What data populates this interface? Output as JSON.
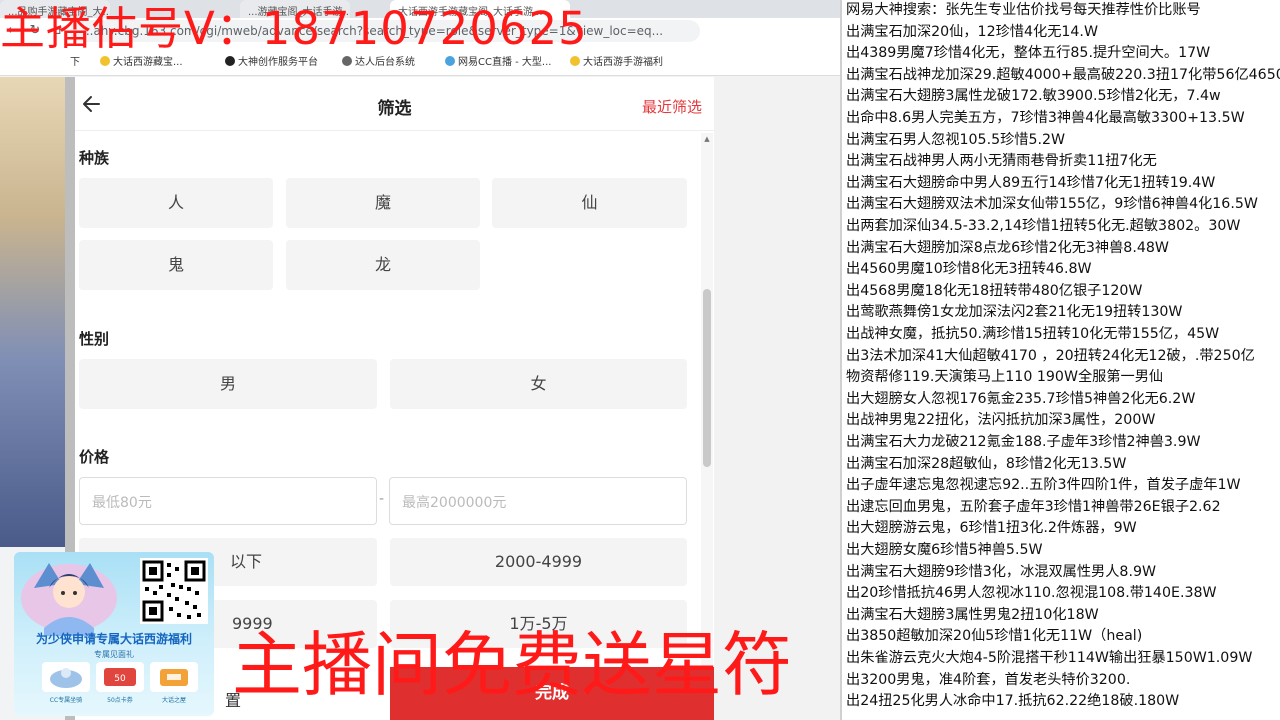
{
  "overlays": {
    "contact_banner": "主播估号V：18710720625",
    "free_banner": "主播间免费送星符"
  },
  "browser": {
    "tabs": [
      "...品购手游藏宝阁_大...",
      "...游藏宝阁_大话手游...",
      "大话西游手游藏宝阁_大话手游..."
    ],
    "url": "...ahy.cbg.163.com/cgi/mweb/advance/search?search_type=role&server_type=1&view_loc=eq...",
    "bookmarks": [
      "下",
      "大话西游藏宝...",
      "大神创作服务平台",
      "达人后台系统",
      "网易CC直播 - 大型...",
      "大话西游手游福利"
    ]
  },
  "filter": {
    "title": "筛选",
    "recent": "最近筛选",
    "race_title": "种族",
    "race_options": [
      "人",
      "魔",
      "仙",
      "鬼",
      "龙"
    ],
    "gender_title": "性别",
    "gender_options": [
      "男",
      "女"
    ],
    "price_title": "价格",
    "price_min_placeholder": "最低80元",
    "price_max_placeholder": "最高2000000元",
    "price_separator": "-",
    "price_options": [
      "以下",
      "2000-4999",
      "9999",
      "1万-5万"
    ],
    "reset_label": "置",
    "confirm_label": "完成"
  },
  "promo": {
    "title": "为少侠申请专属大话西游福利",
    "subtitle": "专属见面礼",
    "item_captions": [
      "CC专属坐骑",
      "50点卡券",
      "大话之屋"
    ]
  },
  "list_lines": [
    "网易大神搜索：张先生专业估价找号每天推荐性价比账号",
    "出满宝石加深20仙，12珍惜4化无14.W",
    "出4389男魔7珍惜4化无，整体五行85.提升空间大。17W",
    "出满宝石战神龙加深29.超敏4000+最高破220.3扭17化带56亿4650",
    "出满宝石大翅膀3属性龙破172.敏3900.5珍惜2化无，7.4w",
    "出命中8.6男人完美五方，7珍惜3神兽4化最高敏3300+13.5W",
    "出满宝石男人忽视105.5珍惜5.2W",
    "出满宝石战神男人两小无猜雨巷骨折卖11扭7化无",
    "出满宝石大翅膀命中男人89五行14珍惜7化无1扭转19.4W",
    "出满宝石大翅膀双法术加深女仙带155亿，9珍惜6神兽4化16.5W",
    "出两套加深仙34.5-33.2,14珍惜1扭转5化无.超敏3802。30W",
    "出满宝石大翅膀加深8点龙6珍惜2化无3神兽8.48W",
    "出4560男魔10珍惜8化无3扭转46.8W",
    "出4568男魔18化无18扭转带480亿银子120W",
    "出莺歌燕舞傍1女龙加深法闪2套21化无19扭转130W",
    "出战神女魔，抵抗50.满珍惜15扭转10化无带155亿，45W",
    "出3法术加深41大仙超敏4170 ，20扭转24化无12破，.带250亿",
    "物资帮修119.天演策马上110 190W全服第一男仙",
    "出大翅膀女人忽视176氪金235.7珍惜5神兽2化无6.2W",
    "出战神男鬼22扭化，法闪抵抗加深3属性，200W",
    "出满宝石大力龙破212氪金188.子虚年3珍惜2神兽3.9W",
    "出满宝石加深28超敏仙，8珍惜2化无13.5W",
    "出子虚年逮忘鬼忽视逮忘92..五阶3件四阶1件，首发子虚年1W",
    "出逮忘回血男鬼，五阶套子虚年3珍惜1神兽带26E银子2.62",
    "出大翅膀游云鬼，6珍惜1扭3化.2件炼器，9W",
    "出大翅膀女魔6珍惜5神兽5.5W",
    "出满宝石大翅膀9珍惜3化，冰混双属性男人8.9W",
    "出20珍惜抵抗46男人忽视冰110.忽视混108.带140E.38W",
    "出满宝石大翅膀3属性男鬼2扭10化18W",
    "出3850超敏加深20仙5珍惜1化无11W（heal)",
    "出朱雀游云克火大炮4-5阶混搭干秒114W输出狂暴150W1.09W",
    "出3200男鬼，准4阶套，首发老头特价3200.",
    "出24扭25化男人冰命中17.抵抗62.22绝18破.180W"
  ]
}
